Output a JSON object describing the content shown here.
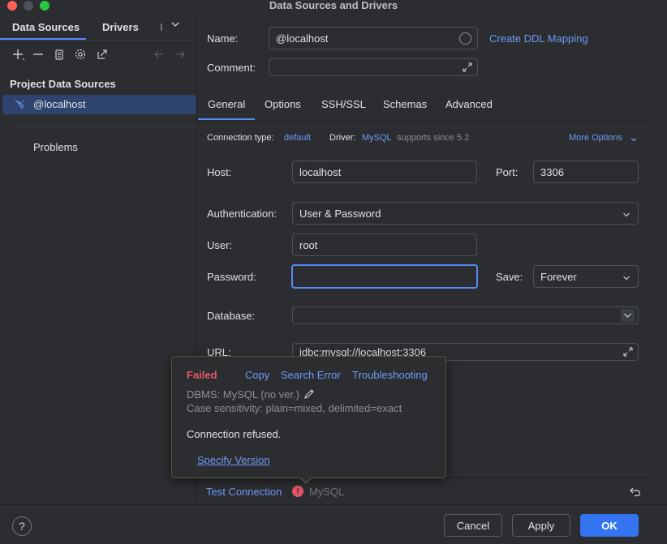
{
  "window": {
    "title": "Data Sources and Drivers"
  },
  "left": {
    "tabs": [
      {
        "label": "Data Sources"
      },
      {
        "label": "Drivers"
      }
    ],
    "tab_overflow": "I",
    "section_title": "Project Data Sources",
    "items": [
      {
        "label": "@localhost"
      }
    ],
    "problems_label": "Problems"
  },
  "general": {
    "name_label": "Name:",
    "name_value": "@localhost",
    "create_ddl_link": "Create DDL Mapping",
    "comment_label": "Comment:",
    "comment_value": ""
  },
  "tabs": [
    {
      "label": "General"
    },
    {
      "label": "Options"
    },
    {
      "label": "SSH/SSL"
    },
    {
      "label": "Schemas"
    },
    {
      "label": "Advanced"
    }
  ],
  "connection": {
    "type_label": "Connection type:",
    "type_value": "default",
    "driver_label": "Driver:",
    "driver_value": "MySQL",
    "driver_note": "supports since 5.2",
    "more_options": "More Options"
  },
  "form": {
    "host_label": "Host:",
    "host_value": "localhost",
    "port_label": "Port:",
    "port_value": "3306",
    "auth_label": "Authentication:",
    "auth_value": "User & Password",
    "user_label": "User:",
    "user_value": "root",
    "password_label": "Password:",
    "password_value": "",
    "save_label": "Save:",
    "save_value": "Forever",
    "database_label": "Database:",
    "database_value": "",
    "url_label": "URL:",
    "url_value": "jdbc:mysql://localhost:3306"
  },
  "popup": {
    "status": "Failed",
    "copy": "Copy",
    "search_error": "Search Error",
    "troubleshooting": "Troubleshooting",
    "dbms": "DBMS: MySQL (no ver.)",
    "case_sensitivity": "Case sensitivity: plain=mixed, delimited=exact",
    "message": "Connection refused.",
    "specify_version": "Specify Version"
  },
  "test": {
    "label": "Test Connection",
    "driver": "MySQL"
  },
  "footer": {
    "help": "?",
    "cancel": "Cancel",
    "apply": "Apply",
    "ok": "OK"
  },
  "colors": {
    "accent": "#3574f0",
    "link": "#6f9bf7",
    "error": "#e55765",
    "selection": "#2e436e"
  }
}
